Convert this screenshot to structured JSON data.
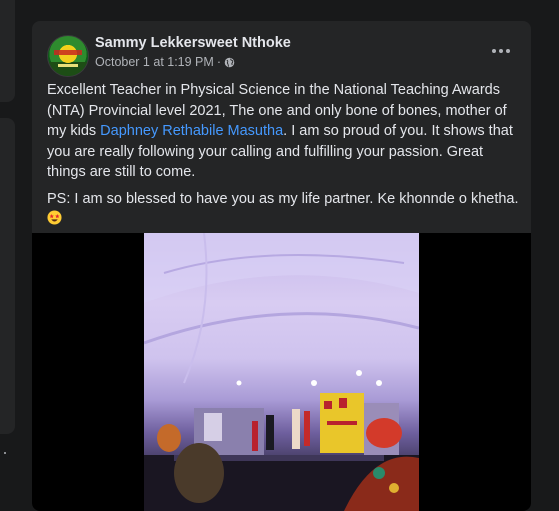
{
  "post": {
    "author": "Sammy Lekkersweet Nthoke",
    "date": "October 1 at 1:19 PM",
    "separator": "·",
    "privacy_icon": "globe-icon",
    "more_icon": "more-options-icon",
    "paragraph1_before": "Excellent Teacher in Physical Science in the National Teaching Awards (NTA) Provincial level 2021, The one and only bone of bones, mother of my kids ",
    "mention": "Daphney Rethabile Masutha",
    "paragraph1_after": ". I am so proud of you. It shows that you are really following your calling and fulfilling your passion. Great things are still to come.",
    "paragraph2": "PS: I am so blessed to have you as my life partner. Ke khonnde o khetha. ",
    "emoji": "star-struck-emoji-icon"
  },
  "colors": {
    "background": "#18191a",
    "card": "#242526",
    "text": "#e4e6eb",
    "secondary_text": "#b0b3b8",
    "link": "#4599ff"
  }
}
